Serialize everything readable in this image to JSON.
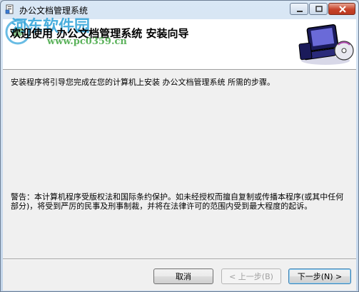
{
  "window": {
    "title": "办公文档管理系统",
    "icon": "installer-icon"
  },
  "header": {
    "title": "欢迎使用  办公文档管理系统  安装向导",
    "watermark_title": "河东软件园",
    "watermark_url": "www.pc0359.cn",
    "art_icon": "computer-cd-icon"
  },
  "content": {
    "intro": "安装程序将引导您完成在您的计算机上安装  办公文档管理系统  所需的步骤。",
    "warning": "警告：本计算机程序受版权法和国际条约保护。如未经授权而擅自复制或传播本程序(或其中任何部分)，将受到严厉的民事及刑事制裁，并将在法律许可的范围内受到最大程度的起诉。"
  },
  "buttons": {
    "cancel": "取消",
    "back": "< 上一步(B)",
    "next": "下一步(N) >"
  },
  "colors": {
    "titlebar": "#d9e7f5",
    "header_bg": "#ffffff",
    "body_bg": "#f0f0f0",
    "close_button": "#c7432a",
    "watermark_blue": "#2aa0d8",
    "watermark_green": "#4aaa4a"
  }
}
